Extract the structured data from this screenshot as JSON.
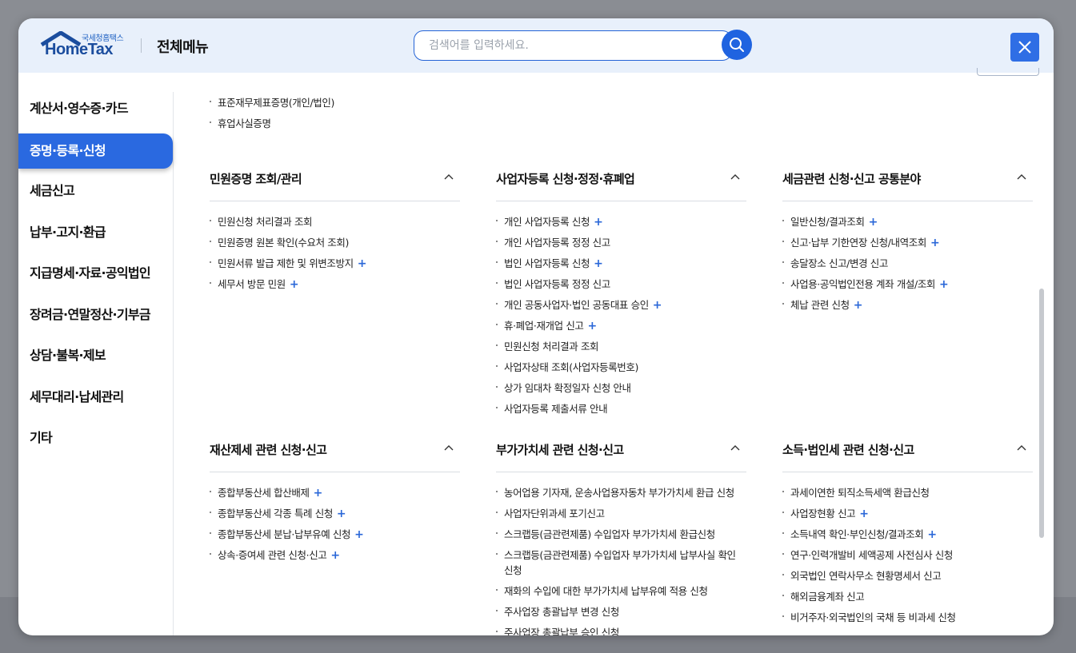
{
  "header": {
    "logo_sub": "국세청홈택스",
    "logo_main": "HomeTax",
    "title": "전체메뉴",
    "search_placeholder": "검색어를 입력하세요.",
    "accent": "#2a69e0"
  },
  "sidebar": {
    "items": [
      {
        "label": "계산서·영수증·카드",
        "active": false
      },
      {
        "label": "증명·등록·신청",
        "active": true
      },
      {
        "label": "세금신고",
        "active": false
      },
      {
        "label": "납부·고지·환급",
        "active": false
      },
      {
        "label": "지급명세·자료·공익법인",
        "active": false
      },
      {
        "label": "장려금·연말정산·기부금",
        "active": false
      },
      {
        "label": "상담·불복·제보",
        "active": false
      },
      {
        "label": "세무대리·납세관리",
        "active": false
      },
      {
        "label": "기타",
        "active": false
      }
    ]
  },
  "content": {
    "top_links": [
      {
        "label": "표준재무제표증명(개인/법인)",
        "plus": false
      },
      {
        "label": "휴업사실증명",
        "plus": false
      }
    ],
    "groups": [
      {
        "title": "민원증명 조회/관리",
        "items": [
          {
            "label": "민원신청 처리결과 조회",
            "plus": false
          },
          {
            "label": "민원증명 원본 확인(수요처 조회)",
            "plus": false
          },
          {
            "label": "민원서류 발급 제한 및 위변조방지",
            "plus": true
          },
          {
            "label": "세무서 방문 민원",
            "plus": true
          }
        ]
      },
      {
        "title": "사업자등록 신청·정정·휴폐업",
        "items": [
          {
            "label": "개인 사업자등록 신청",
            "plus": true
          },
          {
            "label": "개인 사업자등록 정정 신고",
            "plus": false
          },
          {
            "label": "법인 사업자등록 신청",
            "plus": true
          },
          {
            "label": "법인 사업자등록 정정 신고",
            "plus": false
          },
          {
            "label": "개인 공동사업자·법인 공동대표 승인",
            "plus": true
          },
          {
            "label": "휴·폐업·재개업 신고",
            "plus": true
          },
          {
            "label": "민원신청 처리결과 조회",
            "plus": false
          },
          {
            "label": "사업자상태 조회(사업자등록번호)",
            "plus": false
          },
          {
            "label": "상가 임대차 확정일자 신청 안내",
            "plus": false
          },
          {
            "label": "사업자등록 제출서류 안내",
            "plus": false
          }
        ]
      },
      {
        "title": "세금관련 신청·신고 공통분야",
        "items": [
          {
            "label": "일반신청/결과조회",
            "plus": true
          },
          {
            "label": "신고·납부 기한연장 신청/내역조회",
            "plus": true
          },
          {
            "label": "송달장소 신고/변경 신고",
            "plus": false
          },
          {
            "label": "사업용·공익법인전용 계좌 개설/조회",
            "plus": true
          },
          {
            "label": "체납 관련 신청",
            "plus": true
          }
        ]
      },
      {
        "title": "재산제세 관련 신청·신고",
        "items": [
          {
            "label": "종합부동산세 합산배제",
            "plus": true
          },
          {
            "label": "종합부동산세 각종 특례 신청",
            "plus": true
          },
          {
            "label": "종합부동산세 분납·납부유예 신청",
            "plus": true
          },
          {
            "label": "상속·증여세 관련 신청·신고",
            "plus": true
          }
        ]
      },
      {
        "title": "부가가치세 관련 신청·신고",
        "items": [
          {
            "label": "농어업용 기자재, 운송사업용자동차 부가가치세 환급 신청",
            "plus": false
          },
          {
            "label": "사업자단위과세 포기신고",
            "plus": false
          },
          {
            "label": "스크랩등(금관련제품) 수입업자 부가가치세 환급신청",
            "plus": false
          },
          {
            "label": "스크랩등(금관련제품) 수입업자 부가가치세 납부사실 확인신청",
            "plus": false,
            "wrap": true
          },
          {
            "label": "재화의 수입에 대한 부가가치세 납부유예 적용 신청",
            "plus": false
          },
          {
            "label": "주사업장 총괄납부 변경 신청",
            "plus": false
          },
          {
            "label": "주사업장 총괄납부 승인 신청",
            "plus": false
          }
        ]
      },
      {
        "title": "소득·법인세 관련 신청·신고",
        "items": [
          {
            "label": "과세이연한 퇴직소득세액 환급신청",
            "plus": false
          },
          {
            "label": "사업장현황 신고",
            "plus": true
          },
          {
            "label": "소득내역 확인·부인신청/결과조회",
            "plus": true
          },
          {
            "label": "연구·인력개발비 세액공제 사전심사 신청",
            "plus": false
          },
          {
            "label": "외국법인 연락사무소 현황명세서 신고",
            "plus": false
          },
          {
            "label": "해외금융계좌 신고",
            "plus": false
          },
          {
            "label": "비거주자·외국법인의 국채 등 비과세 신청",
            "plus": false
          }
        ]
      }
    ]
  }
}
